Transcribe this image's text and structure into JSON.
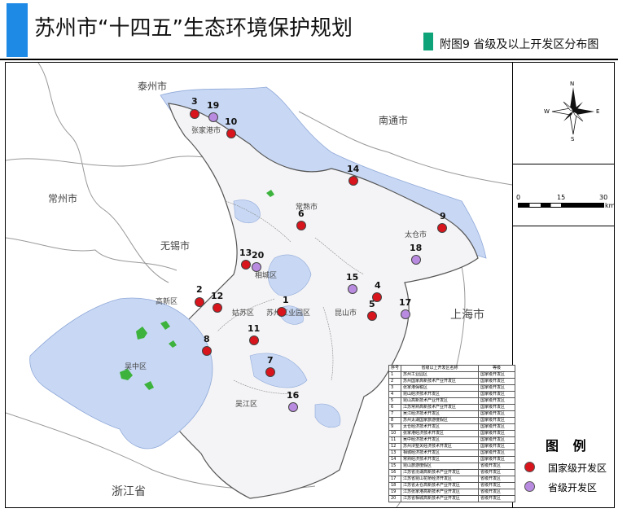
{
  "header": {
    "title": "苏州市“十四五”生态环境保护规划",
    "subtitle": "附图9  省级及以上开发区分布图"
  },
  "colors": {
    "national": "#d8141c",
    "provincial": "#b98be0",
    "water": "#c8d8f4",
    "city": "#f4f4f6"
  },
  "map_labels": {
    "taizhou": "泰州市",
    "nantong": "南通市",
    "changzhou": "常州市",
    "wuxi": "无锡市",
    "shanghai": "上海市",
    "zhejiang": "浙江省",
    "zhangjiagang": "张家港市",
    "changshu": "常熟市",
    "taicang": "太仓市",
    "xiangcheng": "相城区",
    "gaoxin": "高新区",
    "gusu": "姑苏区",
    "suzhou_park": "苏州工业园区",
    "kunshan": "昆山市",
    "wuzhong": "吴中区",
    "wujiang": "吴江区"
  },
  "sites": [
    {
      "id": "1",
      "type": "national"
    },
    {
      "id": "2",
      "type": "national"
    },
    {
      "id": "3",
      "type": "national"
    },
    {
      "id": "4",
      "type": "national"
    },
    {
      "id": "5",
      "type": "national"
    },
    {
      "id": "6",
      "type": "national"
    },
    {
      "id": "7",
      "type": "national"
    },
    {
      "id": "8",
      "type": "national"
    },
    {
      "id": "9",
      "type": "national"
    },
    {
      "id": "10",
      "type": "national"
    },
    {
      "id": "11",
      "type": "national"
    },
    {
      "id": "12",
      "type": "national"
    },
    {
      "id": "13",
      "type": "national"
    },
    {
      "id": "14",
      "type": "national"
    },
    {
      "id": "15",
      "type": "provincial"
    },
    {
      "id": "16",
      "type": "provincial"
    },
    {
      "id": "17",
      "type": "provincial"
    },
    {
      "id": "18",
      "type": "provincial"
    },
    {
      "id": "19",
      "type": "provincial"
    },
    {
      "id": "20",
      "type": "provincial"
    }
  ],
  "compass": {
    "n": "N",
    "s": "S",
    "e": "E",
    "w": "W"
  },
  "scale": {
    "t0": "0",
    "t1": "15",
    "t2": "30",
    "unit": "km"
  },
  "legend": {
    "title": "图 例",
    "national": "国家级开发区",
    "provincial": "省级开发区"
  },
  "table": {
    "headers": [
      "序号",
      "省级以上开发区名称",
      "等级"
    ],
    "rows": [
      [
        "1",
        "苏州工业园区",
        "国家级开发区"
      ],
      [
        "2",
        "苏州国家高新技术产业开发区",
        "国家级开发区"
      ],
      [
        "3",
        "张家港保税区",
        "国家级开发区"
      ],
      [
        "4",
        "昆山经济技术开发区",
        "国家级开发区"
      ],
      [
        "5",
        "昆山高新技术产业开发区",
        "国家级开发区"
      ],
      [
        "6",
        "江苏常熟高新技术产业开发区",
        "国家级开发区"
      ],
      [
        "7",
        "吴江经济技术开发区",
        "国家级开发区"
      ],
      [
        "8",
        "苏州太湖国家旅游度假区",
        "国家级开发区"
      ],
      [
        "9",
        "太仓经济技术开发区",
        "国家级开发区"
      ],
      [
        "10",
        "张家港经济技术开发区",
        "国家级开发区"
      ],
      [
        "11",
        "吴中经济技术开发区",
        "国家级开发区"
      ],
      [
        "12",
        "苏州浒墅关经济技术开发区",
        "国家级开发区"
      ],
      [
        "13",
        "相城经济技术开发区",
        "国家级开发区"
      ],
      [
        "14",
        "常熟经济技术开发区",
        "国家级开发区"
      ],
      [
        "15",
        "昆山旅游度假区",
        "省级开发区"
      ],
      [
        "16",
        "江苏省汾湖高新技术产业开发区",
        "省级开发区"
      ],
      [
        "17",
        "江苏省昆山花桥经济开发区",
        "省级开发区"
      ],
      [
        "18",
        "江苏省太仓高新技术产业开发区",
        "省级开发区"
      ],
      [
        "19",
        "江苏张家港高新技术产业开发区",
        "省级开发区"
      ],
      [
        "20",
        "江苏省相城高新技术产业开发区",
        "省级开发区"
      ]
    ]
  }
}
